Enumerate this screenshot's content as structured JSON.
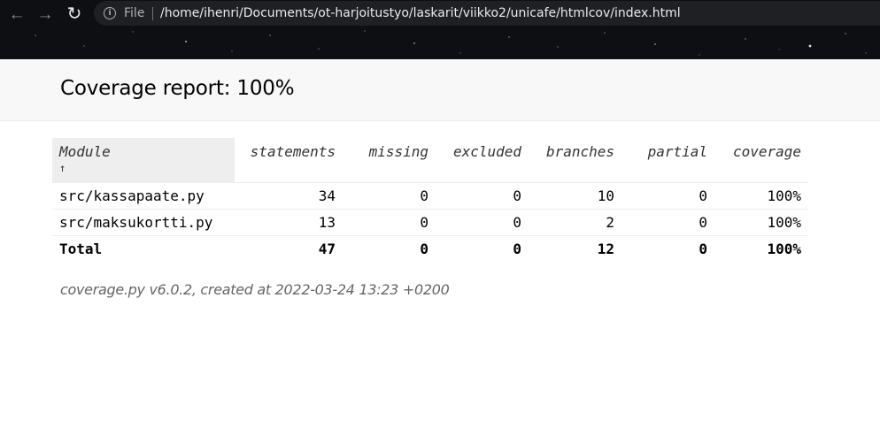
{
  "browser": {
    "file_label": "File",
    "url": "/home/ihenri/Documents/ot-harjoitustyo/laskarit/viikko2/unicafe/htmlcov/index.html"
  },
  "header": {
    "title": "Coverage report: 100%"
  },
  "table": {
    "columns": {
      "module": "Module",
      "sort_indicator": "↑",
      "statements": "statements",
      "missing": "missing",
      "excluded": "excluded",
      "branches": "branches",
      "partial": "partial",
      "coverage": "coverage"
    },
    "rows": [
      {
        "module": "src/kassapaate.py",
        "statements": "34",
        "missing": "0",
        "excluded": "0",
        "branches": "10",
        "partial": "0",
        "coverage": "100%"
      },
      {
        "module": "src/maksukortti.py",
        "statements": "13",
        "missing": "0",
        "excluded": "0",
        "branches": "2",
        "partial": "0",
        "coverage": "100%"
      }
    ],
    "total": {
      "module": "Total",
      "statements": "47",
      "missing": "0",
      "excluded": "0",
      "branches": "12",
      "partial": "0",
      "coverage": "100%"
    }
  },
  "footer": {
    "text": "coverage.py v6.0.2, created at 2022-03-24 13:23 +0200"
  },
  "icons": [
    "back-arrow-icon",
    "forward-arrow-icon",
    "reload-icon",
    "info-icon"
  ],
  "colors": {
    "toolbar_bg": "#0d0f12",
    "omnibox_bg": "#1e2023",
    "header_bg": "#f8f8f8",
    "sorted_header_bg": "#eeeeee"
  }
}
